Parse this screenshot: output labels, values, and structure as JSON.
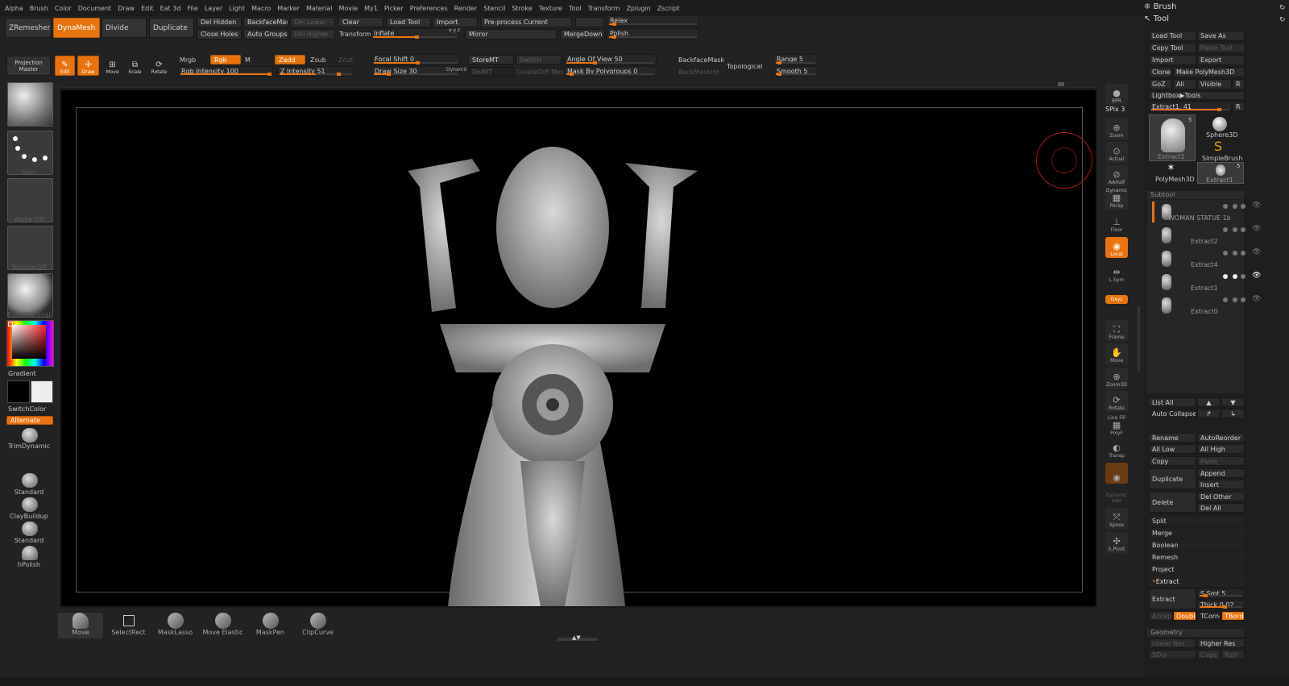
{
  "menu": [
    "Alpha",
    "Brush",
    "Color",
    "Document",
    "Draw",
    "Edit",
    "Eat 3d",
    "File",
    "Layer",
    "Light",
    "Macro",
    "Marker",
    "Material",
    "Movie",
    "My1",
    "Picker",
    "Preferences",
    "Render",
    "Stencil",
    "Stroke",
    "Texture",
    "Tool",
    "Transform",
    "Zplugin",
    "Zscript"
  ],
  "top": {
    "zremesher": "ZRemesher",
    "dynamesh": "DynaMesh",
    "divide": "Divide",
    "duplicate": "Duplicate",
    "del_hidden": "Del Hidden",
    "close_holes": "Close Holes",
    "backface_mask": "BackfaceMask",
    "auto_groups": "Auto Groups",
    "del_lower": "Del Lower",
    "del_higher": "Del Higher",
    "clear": "Clear",
    "transform": "Transform",
    "inflate": "Inflate",
    "xyz": "x y z",
    "load_tool": "Load Tool",
    "import": "Import",
    "mirror": "Mirror",
    "preprocess": "Pre-process Current",
    "merge_down": "MergeDown",
    "relax": "Relax",
    "polish": "Polish"
  },
  "row2": {
    "projection_master": "Projection Master",
    "edit": "Edit",
    "draw": "Draw",
    "move": "Move",
    "scale": "Scale",
    "rotate": "Rotate",
    "mrgb": "Mrgb",
    "rgb": "Rgb",
    "m": "M",
    "rgb_intensity": "Rgb Intensity 100",
    "zadd": "Zadd",
    "zsub": "Zsub",
    "zcut": "Zcut",
    "z_intensity": "Z Intensity 51",
    "focal_shift": "Focal Shift 0",
    "draw_size": "Draw Size 30",
    "dynamic": "Dynamic",
    "store_mt": "StoreMT",
    "del_mt": "DelMT",
    "switch": "Switch",
    "create_diff_mesh": "CreateDiff Mesh",
    "angle_of_view": "Angle Of View 50",
    "mask_by_polygroups": "Mask By Polygroups 0",
    "backface_mask": "BackfaceMask",
    "back_mask_int": "BackMaskInt",
    "topological": "Topological",
    "range": "Range 5",
    "smooth": "Smooth 5"
  },
  "left": {
    "move": "Move",
    "dots": "Dots",
    "alpha_off": "Alpha Off",
    "texture_off": "Texture Off",
    "basic_material": "BasicMaterial",
    "gradient": "Gradient",
    "switch_color": "SwitchColor",
    "alternate": "Alternate",
    "trim_dynamic": "TrimDynamic",
    "standard": "Standard",
    "clay_buildup": "ClayBuildup",
    "standard2": "Standard",
    "hpolish": "hPolish"
  },
  "right_shelf": {
    "bpr": "BPR",
    "spix": "SPix 3",
    "zoom": "Zoom",
    "actual": "Actual",
    "aahalf": "AAHalf",
    "dynamic": "Dynamic",
    "persp": "Persp",
    "floor": "Floor",
    "local": "Local",
    "lsym": "L.Sym",
    "xyz": "Gxyz",
    "frame": "Frame",
    "move": "Move",
    "zoom3d": "Zoom3D",
    "rotate": "Rotate",
    "line_fill": "Line Fill",
    "polyf": "PolyF",
    "transp": "Transp",
    "dynamic2": "Dynamic",
    "solo": "Solo",
    "xpose": "Xpose",
    "spivot": "S.Pivot"
  },
  "panel": {
    "brush": "Brush",
    "tool": "Tool",
    "load_tool": "Load Tool",
    "save_as": "Save As",
    "copy_tool": "Copy Tool",
    "paste_tool": "Paste Tool",
    "import": "Import",
    "export": "Export",
    "clone": "Clone",
    "make_polymesh": "Make PolyMesh3D",
    "goz": "GoZ",
    "all": "All",
    "visible": "Visible",
    "r": "R",
    "lightbox_tools": "Lightbox▶Tools",
    "extract_slider": "Extract1. 41",
    "r2": "R",
    "thumb_extract1": "Extract1",
    "thumb_sphere3d": "Sphere3D",
    "thumb_simplebrush": "SimpleBrush",
    "thumb_polymesh3d": "PolyMesh3D",
    "thumb_extract1b": "Extract1",
    "badge5": "5",
    "badge5b": "5",
    "subtool": "Subtool",
    "subtools": [
      "WOMAN STATUE 1b",
      "Extract2",
      "Extract4",
      "Extract1",
      "Extract0"
    ],
    "list_all": "List All",
    "auto_collapse": "Auto Collapse",
    "rename": "Rename",
    "auto_reorder": "AutoReorder",
    "all_low": "All Low",
    "all_high": "All High",
    "copy": "Copy",
    "paste": "Paste",
    "duplicate": "Duplicate",
    "append": "Append",
    "insert": "Insert",
    "delete": "Delete",
    "del_other": "Del Other",
    "del_all": "Del All",
    "split": "Split",
    "merge": "Merge",
    "boolean": "Boolean",
    "remesh": "Remesh",
    "project": "Project",
    "extract": "Extract",
    "extract_btn": "Extract",
    "s_smt": "S Smt 5",
    "thick": "Thick 0.02",
    "accept": "Accept",
    "double": "Double",
    "tcorne": "TCorne",
    "tborde": "TBorde",
    "geometry": "Geometry",
    "lower_res": "Lower Res",
    "higher_res": "Higher Res",
    "sdiv": "SDiv",
    "cage": "Cage",
    "rstr": "Rstr"
  },
  "bottom": {
    "move": "Move",
    "select_rect": "SelectRect",
    "mask_lasso": "MaskLasso",
    "move_elastic": "Move Elastic",
    "mask_pen": "MaskPen",
    "clip_curve": "ClipCurve"
  },
  "colors": {
    "accent": "#e8730f",
    "bg": "#222222",
    "canvas": "#000000"
  }
}
